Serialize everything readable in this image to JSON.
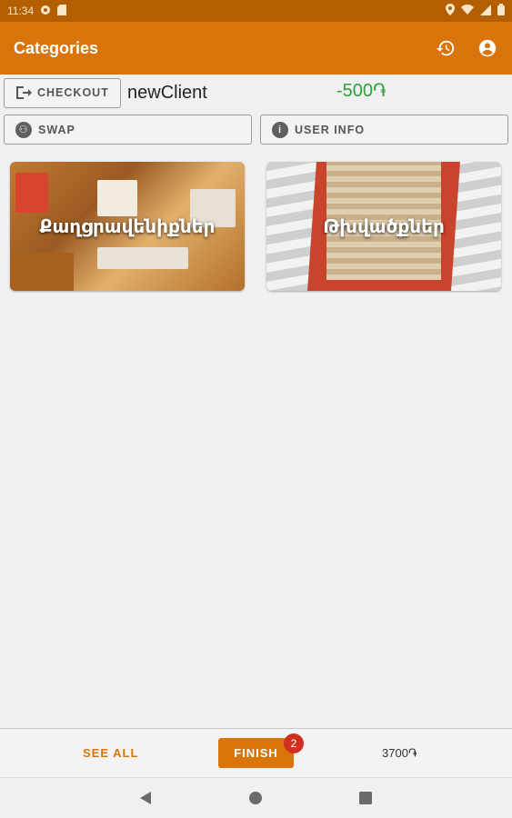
{
  "status_bar": {
    "time": "11:34",
    "left_icons": [
      "gear-icon",
      "sd-card-icon"
    ],
    "right_icons": [
      "location-icon",
      "wifi-icon",
      "signal-icon",
      "battery-icon"
    ]
  },
  "app_bar": {
    "title": "Categories",
    "actions": [
      "history-icon",
      "account-circle-icon"
    ],
    "color": "#d9740a"
  },
  "client_row": {
    "checkout_label": "CHECKOUT",
    "client_name": "newClient",
    "balance": "-500֏",
    "balance_color": "#2e9e3e"
  },
  "actions_row": {
    "swap_label": "SWAP",
    "user_info_label": "USER INFO"
  },
  "categories": [
    {
      "name": "Քաղցրավենիքներ"
    },
    {
      "name": "Թխվածքներ"
    }
  ],
  "bottom_bar": {
    "see_all_label": "SEE ALL",
    "finish_label": "FINISH",
    "badge_count": "2",
    "total": "3700֏"
  },
  "nav_bar": {
    "buttons": [
      "back-icon",
      "home-icon",
      "recents-icon"
    ]
  }
}
